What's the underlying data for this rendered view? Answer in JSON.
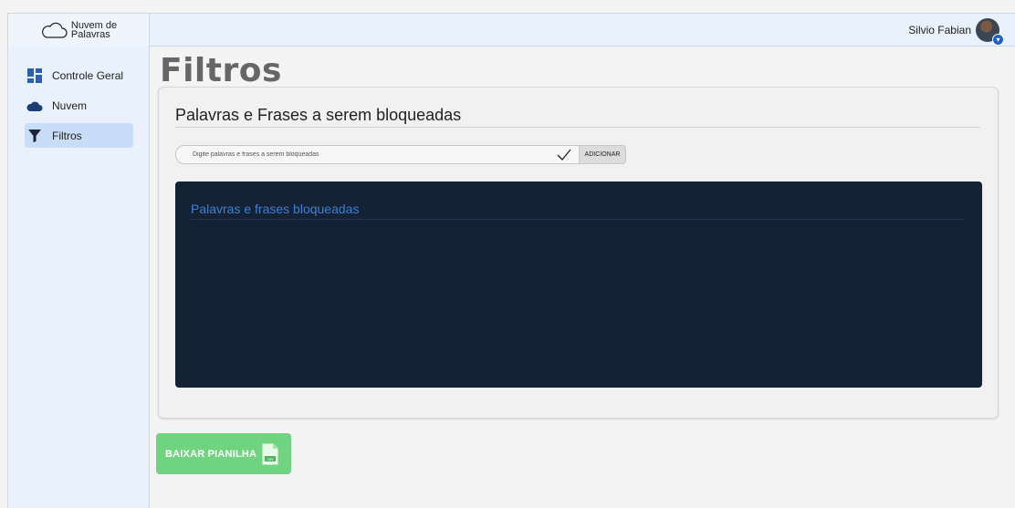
{
  "app": {
    "logo_line1": "Nuvem de",
    "logo_line2": "Palavras"
  },
  "user": {
    "name": "Silvio Fabian"
  },
  "sidebar": {
    "items": [
      {
        "label": "Controle Geral",
        "icon": "dashboard-icon"
      },
      {
        "label": "Nuvem",
        "icon": "cloud-icon"
      },
      {
        "label": "Filtros",
        "icon": "filter-icon",
        "active": true
      }
    ]
  },
  "main": {
    "title": "Filtros",
    "card_title": "Palavras e Frases a serem bloqueadas",
    "input_placeholder": "Digite palavras e frases a serem bloqueadas",
    "add_button_label": "ADICIONAR",
    "blocked_title": "Palavras e frases bloqueadas",
    "download_button_label": "BAIXAR PIANILHA",
    "download_icon": "csv-file-icon"
  },
  "colors": {
    "sidebar_bg": "#e8f1fc",
    "active_item": "#c8ddf7",
    "panel_bg": "#152236",
    "panel_title": "#3f7fd0",
    "download_green": "#6fd37f"
  }
}
